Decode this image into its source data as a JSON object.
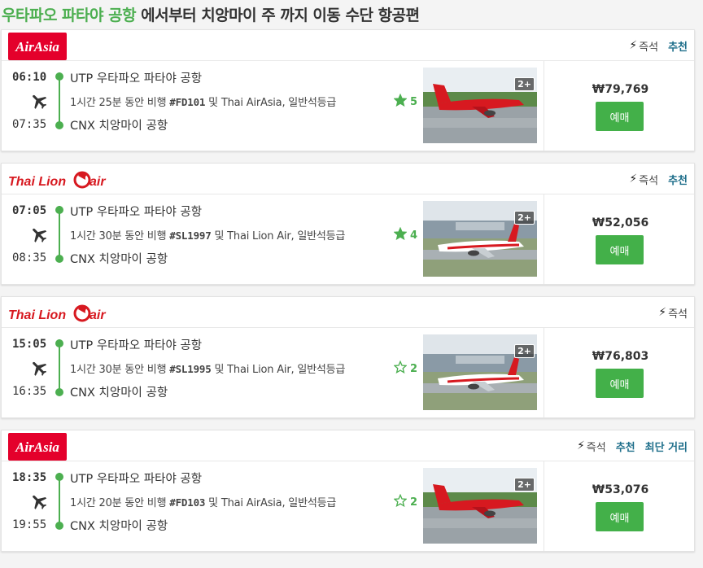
{
  "title": {
    "highlight": "우타파오 파타야 공항",
    "rest": " 에서부터 치앙마이 주 까지 이동 수단 항공편"
  },
  "colors": {
    "accent": "#4caf50",
    "button": "#43b049",
    "link": "#1f6f8b"
  },
  "flights": [
    {
      "airline": "AirAsia",
      "logo_text": "AirAsia",
      "tags": {
        "instant": "즉석",
        "recommend": "추천",
        "shortest": ""
      },
      "dep_time": "06:10",
      "arr_time": "07:35",
      "dep_place": "UTP 우타파오 파타야 공항",
      "arr_place": "CNX 치앙마이 공항",
      "details_pre": "1시간 25분 동안 비행 ",
      "flight_no": "#FD101",
      "details_post": " 및 Thai AirAsia, 일반석등급",
      "rating": "5",
      "photo_badge": "2+",
      "price": "₩79,769",
      "book": "예매"
    },
    {
      "airline": "Thai Lion Air",
      "logo_text": "Thai Lion",
      "tags": {
        "instant": "즉석",
        "recommend": "추천",
        "shortest": ""
      },
      "dep_time": "07:05",
      "arr_time": "08:35",
      "dep_place": "UTP 우타파오 파타야 공항",
      "arr_place": "CNX 치앙마이 공항",
      "details_pre": "1시간 30분 동안 비행 ",
      "flight_no": "#SL1997",
      "details_post": " 및 Thai Lion Air, 일반석등급",
      "rating": "4",
      "photo_badge": "2+",
      "price": "₩52,056",
      "book": "예매"
    },
    {
      "airline": "Thai Lion Air",
      "logo_text": "Thai Lion",
      "tags": {
        "instant": "즉석",
        "recommend": "",
        "shortest": ""
      },
      "dep_time": "15:05",
      "arr_time": "16:35",
      "dep_place": "UTP 우타파오 파타야 공항",
      "arr_place": "CNX 치앙마이 공항",
      "details_pre": "1시간 30분 동안 비행 ",
      "flight_no": "#SL1995",
      "details_post": " 및 Thai Lion Air, 일반석등급",
      "rating": "2",
      "photo_badge": "2+",
      "price": "₩76,803",
      "book": "예매"
    },
    {
      "airline": "AirAsia",
      "logo_text": "AirAsia",
      "tags": {
        "instant": "즉석",
        "recommend": "추천",
        "shortest": "최단 거리"
      },
      "dep_time": "18:35",
      "arr_time": "19:55",
      "dep_place": "UTP 우타파오 파타야 공항",
      "arr_place": "CNX 치앙마이 공항",
      "details_pre": "1시간 20분 동안 비행 ",
      "flight_no": "#FD103",
      "details_post": " 및 Thai AirAsia, 일반석등급",
      "rating": "2",
      "photo_badge": "2+",
      "price": "₩53,076",
      "book": "예매"
    }
  ]
}
